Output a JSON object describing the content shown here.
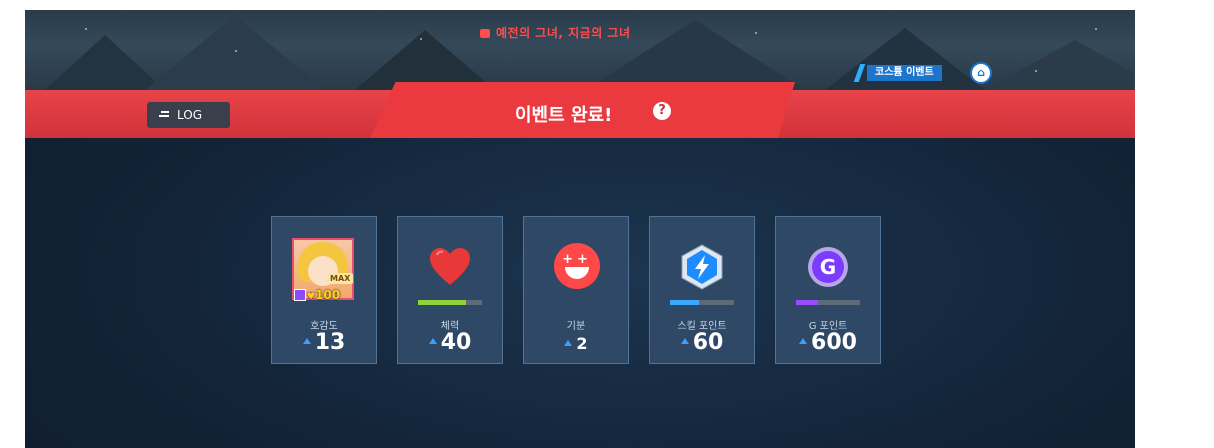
{
  "header": {
    "event_title": "예전의 그녀, 지금의 그녀",
    "costume_event_label": "코스튬 이벤트",
    "costume_icon": "hanger-icon",
    "log_label": "LOG",
    "log_icon": "list-icon",
    "completion_title": "이벤트 완료!",
    "help_icon": "question-icon"
  },
  "stats": [
    {
      "label": "호감도",
      "value": "13",
      "icon": "character-portrait",
      "level": "100",
      "badge": "MAX"
    },
    {
      "label": "체력",
      "value": "40",
      "icon": "heart-icon",
      "bar_fill": 0.75,
      "bar_color": "#8fd23a"
    },
    {
      "label": "기분",
      "value": "2",
      "icon": "happy-face-icon"
    },
    {
      "label": "스킬 포인트",
      "value": "60",
      "icon": "lightning-gem-icon",
      "bar_fill": 0.45,
      "bar_color": "#3aa8ff"
    },
    {
      "label": "G 포인트",
      "value": "600",
      "icon": "g-coin-icon",
      "bar_fill": 0.35,
      "bar_color": "#9b4cff"
    }
  ],
  "colors": {
    "banner": "#d1323a",
    "card_bg": "#2e4866",
    "increase_arrow": "#3aa0ff",
    "event_title_red": "#ff4c4c"
  }
}
